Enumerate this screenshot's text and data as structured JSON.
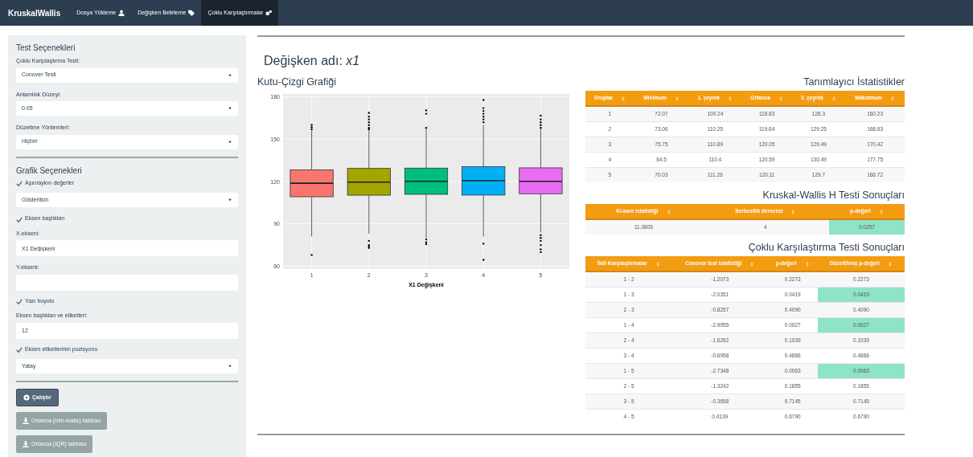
{
  "navbar": {
    "brand": "KruskalWallis",
    "tabs": [
      {
        "label": "Dosya Yükleme",
        "selected": false
      },
      {
        "label": "Değişken Belirleme",
        "selected": false
      },
      {
        "label": "Çoklu Karşılaştırmalar",
        "selected": true
      }
    ]
  },
  "sidebar": {
    "sections": [
      {
        "title": "Test Seçenekleri",
        "controls": [
          {
            "kind": "select",
            "label": "Çoklu Karşılaştırma Testi:",
            "value": "Conover Testi"
          },
          {
            "kind": "select",
            "label": "Anlamlılık Düzeyi:",
            "value": "0.05"
          },
          {
            "kind": "select",
            "label": "Düzeltme Yöntemleri:",
            "value": "Hiçbiri"
          }
        ]
      },
      {
        "title": "Grafik Seçenekleri",
        "controls": [
          {
            "kind": "checkbox",
            "label": "Aşırı/aykırı değerler",
            "checked": true
          },
          {
            "kind": "select",
            "value": "Gösterilsin"
          },
          {
            "kind": "checkbox",
            "label": "Eksen başlıkları",
            "checked": true
          },
          {
            "kind": "text",
            "label": "X-ekseni:",
            "value": "X1 Değişkeni"
          },
          {
            "kind": "text",
            "label": "Y-ekseni:"
          },
          {
            "kind": "checkbox",
            "label": "Yazı boyutu",
            "checked": true
          },
          {
            "kind": "text",
            "label": "Eksen başlıkları ve etiketleri:",
            "value": "12"
          },
          {
            "kind": "checkbox",
            "label": "Eksen etiketlerinin pozisyonu",
            "checked": true
          },
          {
            "kind": "select",
            "value": "Yatay"
          }
        ]
      }
    ],
    "buttons": [
      {
        "label": "Çalıştır",
        "kind": "run"
      },
      {
        "label": "Ortanca (min-maks) tablosu",
        "kind": "download"
      },
      {
        "label": "Ortanca (IQR) tablosu",
        "kind": "download"
      }
    ]
  },
  "main": {
    "title": "Değişken adı: *x1*",
    "plot": {
      "title": "Kutu-Çizgi Grafiği",
      "xlabel": "X1 Değişkeni",
      "xticks": [
        "1",
        "2",
        "3",
        "4",
        "5"
      ],
      "yticks": [
        "180",
        "150",
        "120",
        "90",
        "60"
      ]
    },
    "tables": [
      {
        "title": "Tanımlayıcı İstatistikler",
        "columns": [
          "Gruplar",
          "Minimum",
          "1. çeyrek",
          "Ortanca",
          "3. çeyrek",
          "Maksimum"
        ],
        "rows": [
          {
            "cells": [
              "1",
              "72.07",
              "109.24",
              "118.83",
              "128.3",
              "160.23"
            ]
          },
          {
            "cells": [
              "2",
              "73.06",
              "110.25",
              "119.64",
              "129.25",
              "168.63"
            ]
          },
          {
            "cells": [
              "3",
              "75.75",
              "110.89",
              "120.05",
              "129.49",
              "170.42"
            ]
          },
          {
            "cells": [
              "4",
              "64.5",
              "110.4",
              "120.59",
              "130.49",
              "177.75"
            ]
          },
          {
            "cells": [
              "5",
              "70.03",
              "111.26",
              "120.11",
              "129.7",
              "166.72"
            ]
          }
        ]
      },
      {
        "title": "Kruskal-Wallis H Testi Sonuçları",
        "columns": [
          "Ki-kare istatistiği",
          "Serbestlik derecesi",
          "p-değeri"
        ],
        "rows": [
          {
            "cells": [
              "11.0805",
              "4",
              "0.0257"
            ],
            "significant": true
          }
        ]
      },
      {
        "title": "Çoklu Karşılaştırma Testi Sonuçları",
        "columns": [
          "İkili Karşılaştırmalar",
          "Conover test istatistiği",
          "p-değeri",
          "Düzeltilmiş p-değeri"
        ],
        "rows": [
          {
            "cells": [
              "1 - 2",
              "-1.2073",
              "0.2273",
              "0.2273"
            ],
            "significant": false
          },
          {
            "cells": [
              "1 - 3",
              "-2.0351",
              "0.0419",
              "0.0419"
            ],
            "significant": true
          },
          {
            "cells": [
              "2 - 3",
              "-0.8257",
              "0.4090",
              "0.4090"
            ],
            "significant": false
          },
          {
            "cells": [
              "1 - 4",
              "-2.9955",
              "0.0027",
              "0.0027"
            ],
            "significant": true
          },
          {
            "cells": [
              "2 - 4",
              "-1.6262",
              "0.1039",
              "0.1039"
            ],
            "significant": false
          },
          {
            "cells": [
              "3 - 4",
              "-0.6958",
              "0.4866",
              "0.4866"
            ],
            "significant": false
          },
          {
            "cells": [
              "1 - 5",
              "-2.7348",
              "0.0063",
              "0.0063"
            ],
            "significant": true
          },
          {
            "cells": [
              "2 - 5",
              "-1.3242",
              "0.1855",
              "0.1855"
            ],
            "significant": false
          },
          {
            "cells": [
              "3 - 5",
              "-0.3658",
              "0.7145",
              "0.7145"
            ],
            "significant": false
          },
          {
            "cells": [
              "4 - 5",
              "0.4139",
              "0.6790",
              "0.6790"
            ],
            "significant": false
          }
        ]
      }
    ]
  }
}
